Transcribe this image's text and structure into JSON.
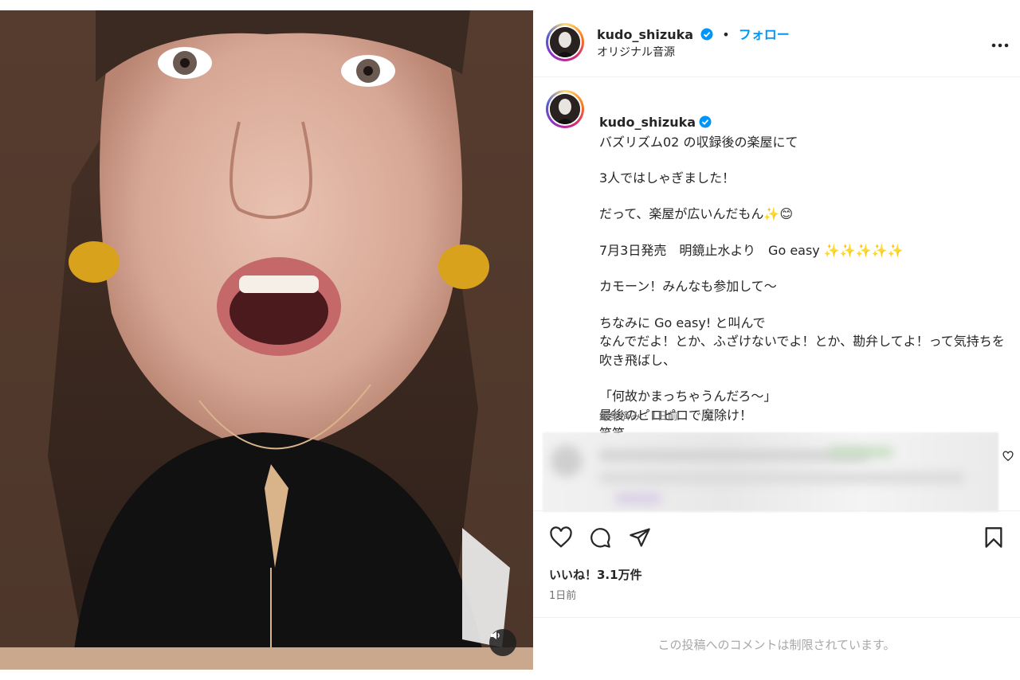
{
  "post": {
    "username": "kudo_shizuka",
    "follow_label": "フォロー",
    "audio_label": "オリジナル音源",
    "caption_title": "バズリズム02 の収録後の楽屋にて",
    "caption_lines": [
      "3人ではしゃぎました！",
      "だって、楽屋が広いんだもん✨😊",
      "7月3日発売　明鏡止水より　Go easy ✨✨✨✨✨",
      "カモーン！みんなも参加して〜",
      "ちなみに Go easy! と叫んで\nなんでだよ！とか、ふざけないでよ！とか、勘弁してよ！って気持ちを吹き飛ばし、",
      "「何故かまっちゃうんだろ〜」\n最後のピロピロで魔除け！\n笑笑"
    ],
    "caption_meta": "編集済み · 1日前",
    "likes": "いいね！3.1万件",
    "age": "1日前",
    "comments_notice": "この投稿へのコメントは制限されています。"
  },
  "icons": {
    "more": "more-options-icon",
    "verified": "verified-badge-icon",
    "sound": "speaker-icon",
    "like": "heart-icon",
    "comment": "comment-bubble-icon",
    "share": "paper-plane-icon",
    "save": "bookmark-icon"
  },
  "colors": {
    "accent": "#0095f6",
    "verified": "#0095f6",
    "muted": "#737373"
  }
}
